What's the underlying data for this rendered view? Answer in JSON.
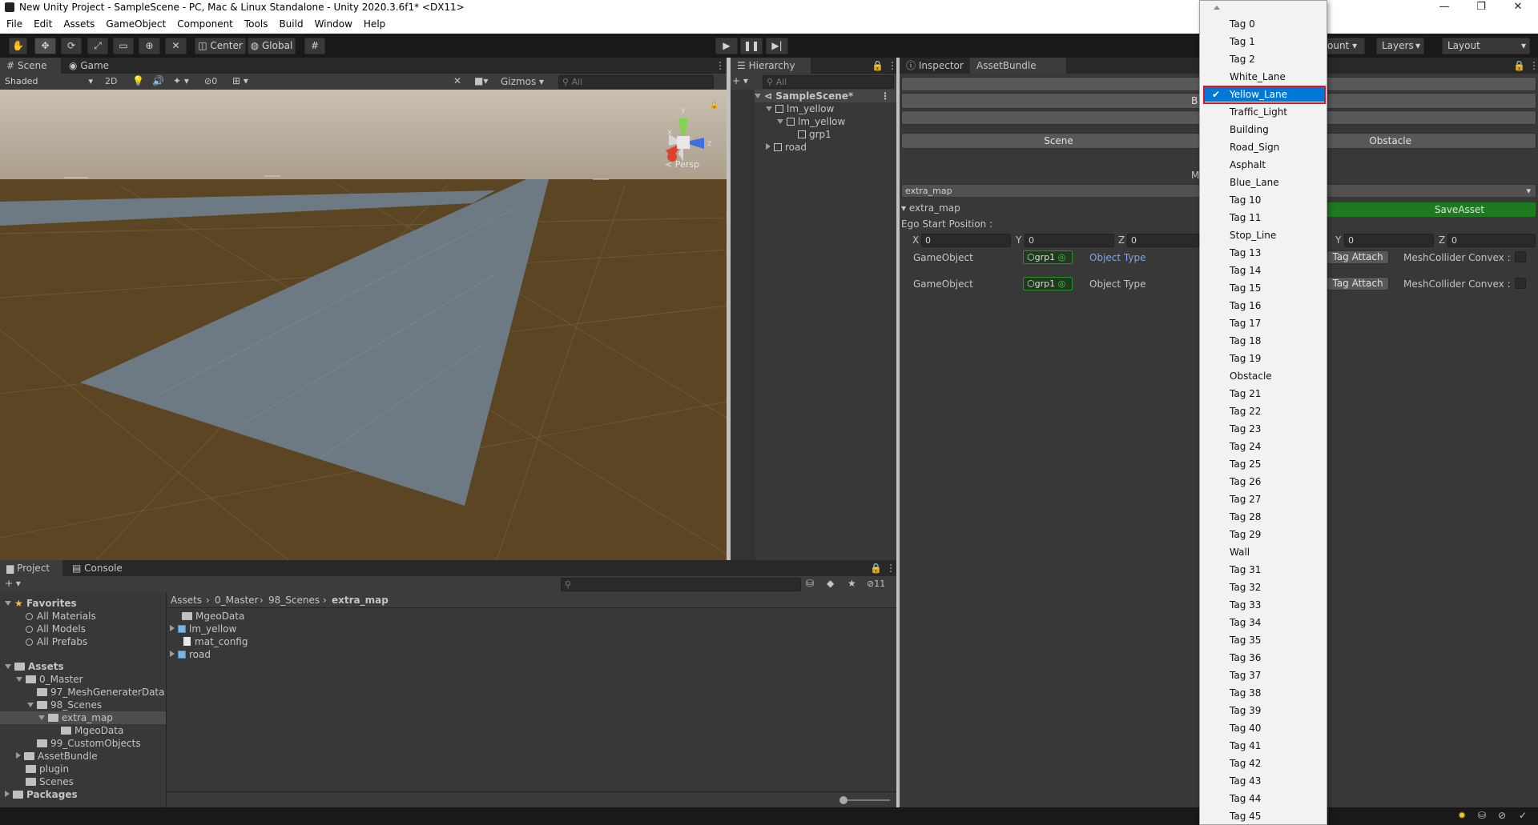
{
  "window": {
    "title": "New Unity Project - SampleScene - PC, Mac & Linux Standalone - Unity 2020.3.6f1* <DX11>",
    "minimize": "—",
    "maximize": "❐",
    "close": "✕"
  },
  "menu": [
    "File",
    "Edit",
    "Assets",
    "GameObject",
    "Component",
    "Tools",
    "Build",
    "Window",
    "Help"
  ],
  "toolbar": {
    "pivot": "Center",
    "space": "Global",
    "account": "ount",
    "layers": "Layers",
    "layout": "Layout"
  },
  "scene": {
    "tabs": [
      "Scene",
      "Game"
    ],
    "shading": "Shaded",
    "mode_2d": "2D",
    "hidden_count": "0",
    "gizmos": "Gizmos",
    "search_placeholder": "All",
    "persp_label": "< Persp",
    "axis_y": "y",
    "axis_x": "x",
    "axis_z": "z",
    "colors": {
      "ground": "#5b4523",
      "sky": "#b7ab9b",
      "road": "#6f7f8f"
    }
  },
  "hierarchy": {
    "title": "Hierarchy",
    "search_placeholder": "All",
    "items": [
      {
        "label": "SampleScene*",
        "depth": 0
      },
      {
        "label": "lm_yellow",
        "depth": 1
      },
      {
        "label": "lm_yellow",
        "depth": 2
      },
      {
        "label": "grp1",
        "depth": 3
      },
      {
        "label": "road",
        "depth": 1
      }
    ]
  },
  "inspector": {
    "tabs": [
      "Inspector",
      "AssetBundle Editor"
    ],
    "partial_button": "B",
    "scene_button": "Scene",
    "obstacle_button": "Obstacle",
    "partial_label": "M",
    "map_select": "extra_map",
    "save_button": "SaveAsset",
    "foldout": "extra_map",
    "ego_label": "Ego Start Position :",
    "pos_left": [
      {
        "axis": "X",
        "value": "0"
      },
      {
        "axis": "Y",
        "value": "0"
      },
      {
        "axis": "Z",
        "value": "0"
      }
    ],
    "pos_right": [
      {
        "axis": "Y",
        "value": "0"
      },
      {
        "axis": "Z",
        "value": "0"
      }
    ],
    "rows": [
      {
        "label": "GameObject",
        "object": "grp1",
        "type": "Object Type",
        "tag_button": "Tag Attach",
        "convex": "MeshCollider Convex :"
      },
      {
        "label": "GameObject",
        "object": "grp1",
        "type": "Object Type",
        "tag_button": "Tag Attach",
        "convex": "MeshCollider Convex :"
      }
    ]
  },
  "project": {
    "tabs": [
      "Project",
      "Console"
    ],
    "hidden_count": "11",
    "breadcrumb": [
      "Assets",
      "0_Master",
      "98_Scenes",
      "extra_map"
    ],
    "favorites_title": "Favorites",
    "favorites": [
      "All Materials",
      "All Models",
      "All Prefabs"
    ],
    "assets_title": "Assets",
    "tree": [
      {
        "label": "0_Master",
        "depth": 1
      },
      {
        "label": "97_MeshGeneraterData",
        "depth": 2
      },
      {
        "label": "98_Scenes",
        "depth": 2
      },
      {
        "label": "extra_map",
        "depth": 3
      },
      {
        "label": "MgeoData",
        "depth": 4
      },
      {
        "label": "99_CustomObjects",
        "depth": 2
      },
      {
        "label": "AssetBundle",
        "depth": 1
      },
      {
        "label": "plugin",
        "depth": 1
      },
      {
        "label": "Scenes",
        "depth": 1
      }
    ],
    "packages_title": "Packages",
    "files": [
      {
        "label": "MgeoData",
        "kind": "folder"
      },
      {
        "label": "lm_yellow",
        "kind": "model"
      },
      {
        "label": "mat_config",
        "kind": "doc"
      },
      {
        "label": "road",
        "kind": "model"
      }
    ]
  },
  "popup": {
    "selected_index": 4,
    "options": [
      "Tag 0",
      "Tag 1",
      "Tag 2",
      "White_Lane",
      "Yellow_Lane",
      "Traffic_Light",
      "Building",
      "Road_Sign",
      "Asphalt",
      "Blue_Lane",
      "Tag 10",
      "Tag 11",
      "Stop_Line",
      "Tag 13",
      "Tag 14",
      "Tag 15",
      "Tag 16",
      "Tag 17",
      "Tag 18",
      "Tag 19",
      "Obstacle",
      "Tag 21",
      "Tag 22",
      "Tag 23",
      "Tag 24",
      "Tag 25",
      "Tag 26",
      "Tag 27",
      "Tag 28",
      "Tag 29",
      "Wall",
      "Tag 31",
      "Tag 32",
      "Tag 33",
      "Tag 34",
      "Tag 35",
      "Tag 36",
      "Tag 37",
      "Tag 38",
      "Tag 39",
      "Tag 40",
      "Tag 41",
      "Tag 42",
      "Tag 43",
      "Tag 44",
      "Tag 45"
    ]
  }
}
